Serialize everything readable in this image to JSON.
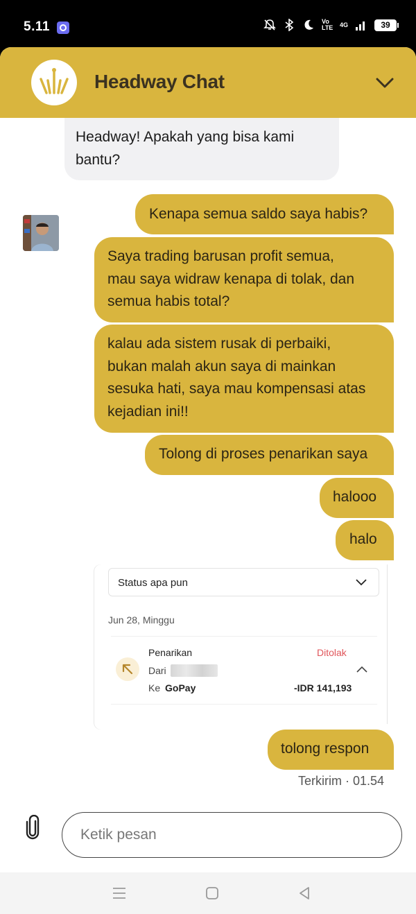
{
  "status_bar": {
    "time": "5.11",
    "network": "4G",
    "volte": "Vo LTE",
    "battery": "39"
  },
  "header": {
    "title": "Headway Chat"
  },
  "messages": {
    "incoming_partial": [
      "Headway! Apakah yang bisa kami",
      "bantu?"
    ],
    "outgoing": [
      [
        "Kenapa semua saldo saya habis?"
      ],
      [
        "Saya trading barusan profit semua,",
        "mau saya widraw kenapa di tolak, dan",
        "semua habis total?"
      ],
      [
        "kalau ada sistem rusak di perbaiki,",
        "bukan malah akun saya di mainkan",
        "sesuka hati, saya mau kompensasi atas",
        "kejadian ini!!"
      ],
      [
        "Tolong di proses penarikan saya"
      ],
      [
        "halooo"
      ],
      [
        "halo"
      ]
    ],
    "last": [
      "tolong respon"
    ],
    "delivery_status": "Terkirim · 01.54"
  },
  "attachment_card": {
    "filter": "Status apa pun",
    "date": "Jun 28, Minggu",
    "tx_type": "Penarikan",
    "tx_status": "Ditolak",
    "from_label": "Dari",
    "to_label": "Ke",
    "to_value": "GoPay",
    "amount": "-IDR 141,193"
  },
  "composer": {
    "placeholder": "Ketik pesan"
  },
  "colors": {
    "accent": "#d9b53e",
    "incoming_bubble": "#f1f1f3",
    "rejected": "#e0555a"
  }
}
